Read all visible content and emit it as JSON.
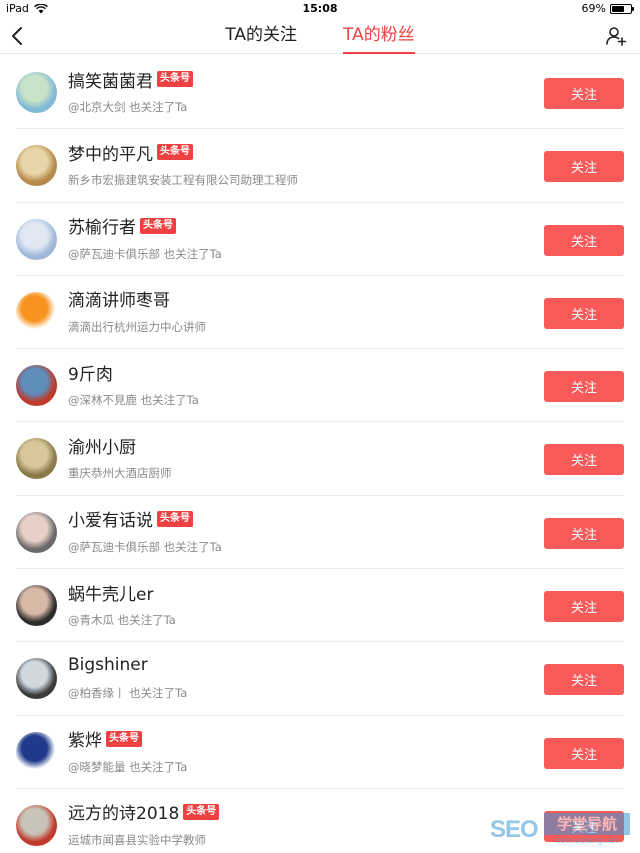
{
  "status_bar": {
    "device": "iPad",
    "time": "15:08",
    "battery_text": "69%",
    "battery_level": 0.69
  },
  "nav": {
    "tabs": [
      {
        "label": "TA的关注",
        "active": false
      },
      {
        "label": "TA的粉丝",
        "active": true
      }
    ],
    "back_icon": "chevron-left-icon",
    "add_user_icon": "add-user-icon",
    "accent_color": "#f04142"
  },
  "follow_label": "关注",
  "badge_label": "头条号",
  "users": [
    {
      "name": "搞笑菌菌君",
      "badge": true,
      "desc": "@北京大剑 也关注了Ta",
      "avatar_colors": [
        "#7fb9d6",
        "#c9e2c7"
      ]
    },
    {
      "name": "梦中的平凡",
      "badge": true,
      "desc": "新乡市宏振建筑安装工程有限公司助理工程师",
      "avatar_colors": [
        "#b58a4a",
        "#e8d6a8"
      ]
    },
    {
      "name": "苏榆行者",
      "badge": true,
      "desc": "@萨瓦迪卡俱乐部 也关注了Ta",
      "avatar_colors": [
        "#9fb8d8",
        "#dfe8f3"
      ]
    },
    {
      "name": "滴滴讲师枣哥",
      "badge": false,
      "desc": "滴滴出行杭州运力中心讲师",
      "avatar_colors": [
        "#ffffff",
        "#f7931e"
      ]
    },
    {
      "name": "9斤肉",
      "badge": false,
      "desc": "@深林不見鹿 也关注了Ta",
      "avatar_colors": [
        "#c0392b",
        "#5d8db8"
      ]
    },
    {
      "name": "渝州小厨",
      "badge": false,
      "desc": "重庆恭州大酒店厨师",
      "avatar_colors": [
        "#8a7a4a",
        "#d8c79a"
      ]
    },
    {
      "name": "小爱有话说",
      "badge": true,
      "desc": "@萨瓦迪卡俱乐部 也关注了Ta",
      "avatar_colors": [
        "#6a6a6a",
        "#e8d0c8"
      ]
    },
    {
      "name": "蜗牛壳儿er",
      "badge": false,
      "desc": "@青木瓜 也关注了Ta",
      "avatar_colors": [
        "#2c2c2c",
        "#d9b8a8"
      ]
    },
    {
      "name": "Bigshiner",
      "badge": false,
      "desc": "@柏香缘丨 也关注了Ta",
      "avatar_colors": [
        "#3a3a3a",
        "#cfd8df"
      ]
    },
    {
      "name": "紫烨",
      "badge": true,
      "desc": "@晓梦能量 也关注了Ta",
      "avatar_colors": [
        "#ffffff",
        "#1f3a8a"
      ]
    },
    {
      "name": "远方的诗2018",
      "badge": true,
      "desc": "运城市闻喜县实验中学教师",
      "avatar_colors": [
        "#c0392b",
        "#c9c4b8"
      ]
    }
  ],
  "watermark": {
    "brand": "SEO",
    "cn": "学堂导航",
    "url": "seoxuetang.net"
  }
}
